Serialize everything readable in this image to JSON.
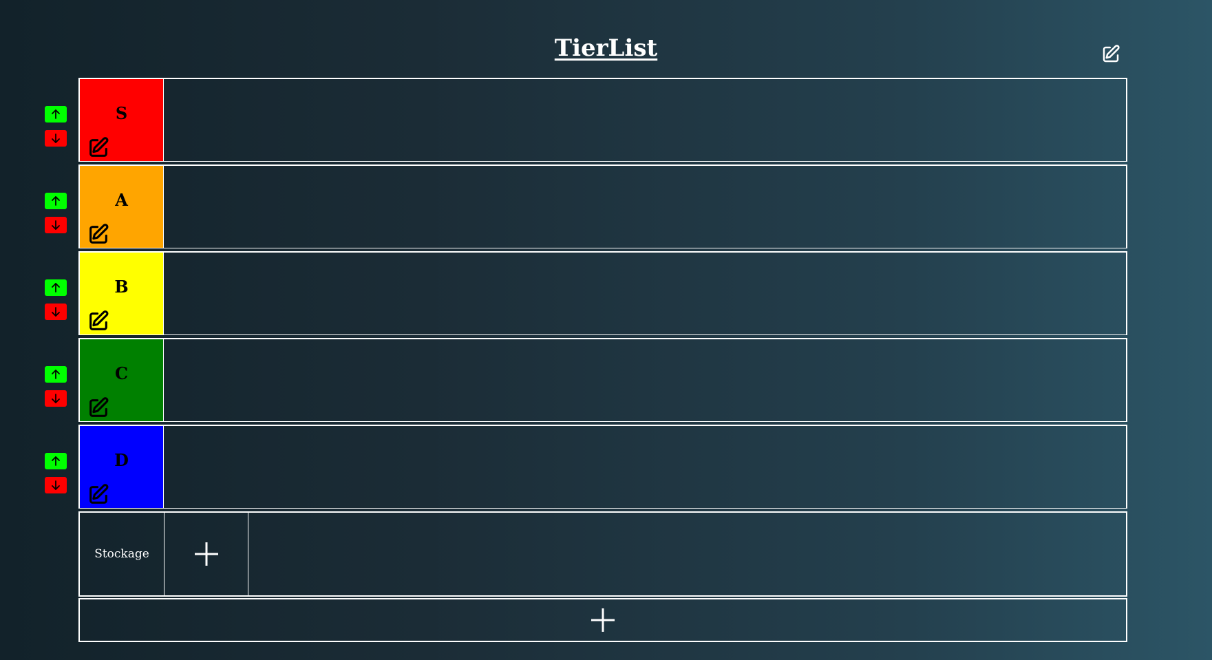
{
  "header": {
    "title": "TierList",
    "edit_icon": "pencil-square-icon"
  },
  "tiers": [
    {
      "label": "S",
      "color": "#ff0000"
    },
    {
      "label": "A",
      "color": "#ffa500"
    },
    {
      "label": "B",
      "color": "#ffff00"
    },
    {
      "label": "C",
      "color": "#008000"
    },
    {
      "label": "D",
      "color": "#0000ff"
    }
  ],
  "controls": {
    "move_up_color": "#00ff00",
    "move_down_color": "#ff0000",
    "move_up_icon": "arrow-up-icon",
    "move_down_icon": "arrow-down-icon"
  },
  "storage": {
    "label": "Stockage",
    "add_icon": "plus-icon"
  },
  "add_tier": {
    "icon": "plus-icon"
  }
}
